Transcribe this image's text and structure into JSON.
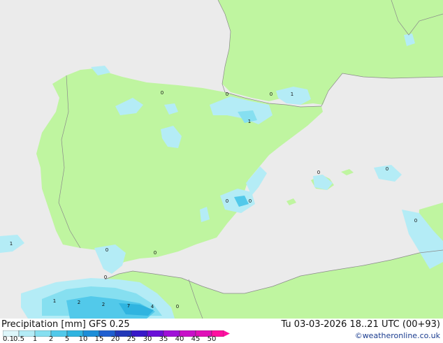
{
  "footer": {
    "title": "Precipitation [mm]  GFS 0.25",
    "datetime": "Tu 03-03-2026 18..21 UTC (00+93)",
    "credit": "©weatheronline.co.uk"
  },
  "legend": {
    "ticks": [
      "0.1",
      "0.5",
      "1",
      "2",
      "5",
      "10",
      "15",
      "20",
      "25",
      "30",
      "35",
      "40",
      "45",
      "50"
    ],
    "colors": [
      "#ddf6fa",
      "#b4ecf6",
      "#86dff0",
      "#52c9ea",
      "#2fb4e0",
      "#1c8ed8",
      "#1f5fd0",
      "#2238b8",
      "#3818c8",
      "#6a10d8",
      "#a010d8",
      "#c810c8",
      "#e010b8",
      "#ff10a0"
    ]
  },
  "map_labels": [
    {
      "text": "0"
    },
    {
      "text": "0"
    },
    {
      "text": "0"
    },
    {
      "text": "1"
    },
    {
      "text": "1"
    },
    {
      "text": "0"
    },
    {
      "text": "0"
    },
    {
      "text": "0"
    },
    {
      "text": "0"
    },
    {
      "text": "0"
    },
    {
      "text": "1"
    },
    {
      "text": "0"
    },
    {
      "text": "0"
    },
    {
      "text": "0"
    },
    {
      "text": "1"
    },
    {
      "text": "2"
    },
    {
      "text": "2"
    },
    {
      "text": "7"
    },
    {
      "text": "4"
    },
    {
      "text": "0"
    }
  ],
  "colors": {
    "land": "#bff5a0",
    "sea": "#ebebeb",
    "outside_land": "#ebebeb",
    "border": "#8a8a8a"
  }
}
